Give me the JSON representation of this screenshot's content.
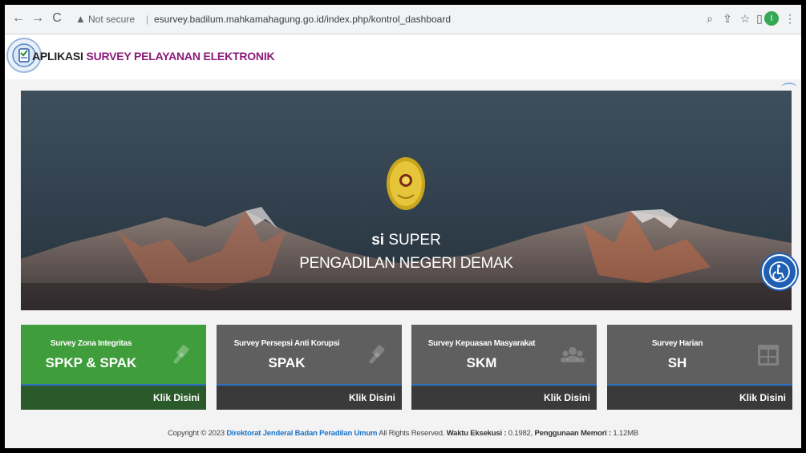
{
  "browser": {
    "security_label": "Not secure",
    "url": "esurvey.badilum.mahkamahagung.go.id/index.php/kontrol_dashboard",
    "profile_initial": "I"
  },
  "header": {
    "brand_part1": "APLIKASI",
    "brand_part2": "SURVEY PELAYANAN ELEKTRONIK"
  },
  "hero": {
    "title_bold": "si",
    "title_rest": "SUPER",
    "subtitle": "PENGADILAN NEGERI DEMAK"
  },
  "cards": [
    {
      "label": "Survey Zona Integritas",
      "code": "SPKP & SPAK",
      "link": "Klik Disini",
      "icon": "gavel-icon",
      "color": "#3f9d3c"
    },
    {
      "label": "Survey Persepsi Anti Korupsi",
      "code": "SPAK",
      "link": "Klik Disini",
      "icon": "gavel-icon",
      "color": "#5f5f5f"
    },
    {
      "label": "Survey Kepuasan Masyarakat",
      "code": "SKM",
      "link": "Klik Disini",
      "icon": "users-icon",
      "color": "#5f5f5f"
    },
    {
      "label": "Survey Harian",
      "code": "SH",
      "link": "Klik Disini",
      "icon": "grid-icon",
      "color": "#5f5f5f"
    }
  ],
  "footer": {
    "prefix": "Copyright © 2023",
    "org": "Direktorat Jenderal Badan Peradilan Umum",
    "rights": "All Rights Reserved.",
    "exec_label": "Waktu Eksekusi :",
    "exec_value": "0.1982,",
    "mem_label": "Penggunaan Memori :",
    "mem_value": "1.12MB"
  }
}
